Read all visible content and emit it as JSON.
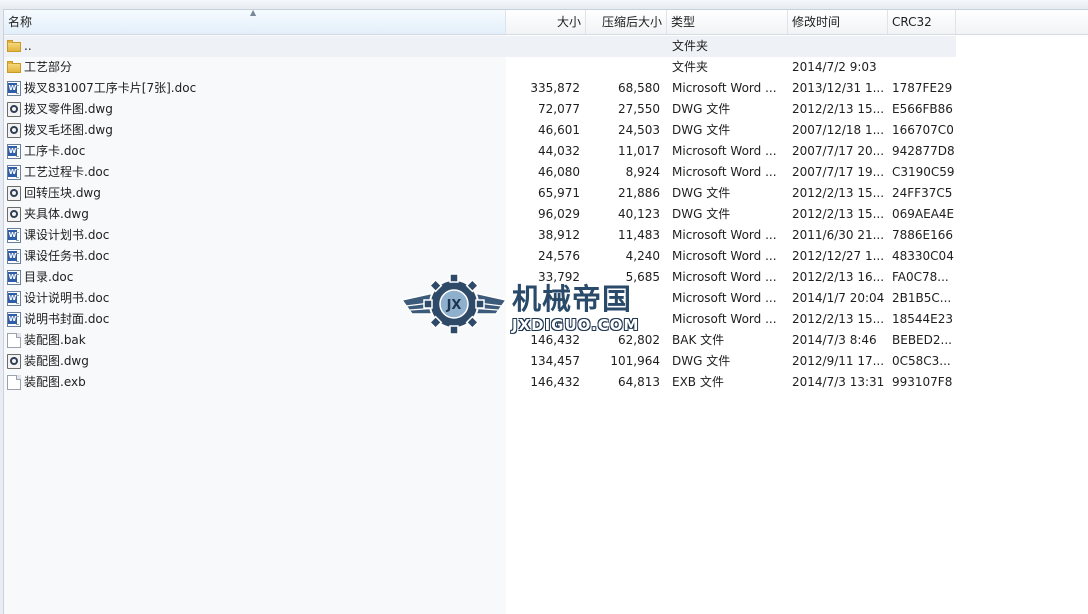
{
  "columns": {
    "name": "名称",
    "size": "大小",
    "compressed": "压缩后大小",
    "type": "类型",
    "modified": "修改时间",
    "crc": "CRC32"
  },
  "files": [
    {
      "name": "..",
      "icon": "folder-icon",
      "size": "",
      "compressed": "",
      "type": "文件夹",
      "modified": "",
      "crc": ""
    },
    {
      "name": "工艺部分",
      "icon": "folder-icon",
      "size": "",
      "compressed": "",
      "type": "文件夹",
      "modified": "2014/7/2 9:03",
      "crc": ""
    },
    {
      "name": "拨叉831007工序卡片[7张].doc",
      "icon": "word-doc-icon",
      "size": "335,872",
      "compressed": "68,580",
      "type": "Microsoft Word ...",
      "modified": "2013/12/31 1...",
      "crc": "1787FE29"
    },
    {
      "name": "拨叉零件图.dwg",
      "icon": "dwg-file-icon",
      "size": "72,077",
      "compressed": "27,550",
      "type": "DWG 文件",
      "modified": "2012/2/13 15...",
      "crc": "E566FB86"
    },
    {
      "name": "拨叉毛坯图.dwg",
      "icon": "dwg-file-icon",
      "size": "46,601",
      "compressed": "24,503",
      "type": "DWG 文件",
      "modified": "2007/12/18 1...",
      "crc": "166707C0"
    },
    {
      "name": "工序卡.doc",
      "icon": "word-doc-icon",
      "size": "44,032",
      "compressed": "11,017",
      "type": "Microsoft Word ...",
      "modified": "2007/7/17 20...",
      "crc": "942877D8"
    },
    {
      "name": "工艺过程卡.doc",
      "icon": "word-doc-icon",
      "size": "46,080",
      "compressed": "8,924",
      "type": "Microsoft Word ...",
      "modified": "2007/7/17 19...",
      "crc": "C3190C59"
    },
    {
      "name": "回转压块.dwg",
      "icon": "dwg-file-icon",
      "size": "65,971",
      "compressed": "21,886",
      "type": "DWG 文件",
      "modified": "2012/2/13 15...",
      "crc": "24FF37C5"
    },
    {
      "name": "夹具体.dwg",
      "icon": "dwg-file-icon",
      "size": "96,029",
      "compressed": "40,123",
      "type": "DWG 文件",
      "modified": "2012/2/13 15...",
      "crc": "069AEA4E"
    },
    {
      "name": "课设计划书.doc",
      "icon": "word-doc-icon",
      "size": "38,912",
      "compressed": "11,483",
      "type": "Microsoft Word ...",
      "modified": "2011/6/30 21...",
      "crc": "7886E166"
    },
    {
      "name": "课设任务书.doc",
      "icon": "word-doc-icon",
      "size": "24,576",
      "compressed": "4,240",
      "type": "Microsoft Word ...",
      "modified": "2012/12/27 1...",
      "crc": "48330C04"
    },
    {
      "name": "目录.doc",
      "icon": "word-doc-icon",
      "size": "33,792",
      "compressed": "5,685",
      "type": "Microsoft Word ...",
      "modified": "2012/2/13 16...",
      "crc": "FA0C78..."
    },
    {
      "name": "设计说明书.doc",
      "icon": "word-doc-icon",
      "size": "",
      "compressed": "",
      "type": "Microsoft Word ...",
      "modified": "2014/1/7 20:04",
      "crc": "2B1B5C..."
    },
    {
      "name": "说明书封面.doc",
      "icon": "word-doc-icon",
      "size": "",
      "compressed": "",
      "type": "Microsoft Word ...",
      "modified": "2012/2/13 15...",
      "crc": "18544E23"
    },
    {
      "name": "装配图.bak",
      "icon": "blank-file-icon",
      "size": "146,432",
      "compressed": "62,802",
      "type": "BAK 文件",
      "modified": "2014/7/3 8:46",
      "crc": "BEBED2..."
    },
    {
      "name": "装配图.dwg",
      "icon": "dwg-file-icon",
      "size": "134,457",
      "compressed": "101,964",
      "type": "DWG 文件",
      "modified": "2012/9/11 17...",
      "crc": "0C58C3..."
    },
    {
      "name": "装配图.exb",
      "icon": "blank-file-icon",
      "size": "146,432",
      "compressed": "64,813",
      "type": "EXB 文件",
      "modified": "2014/7/3 13:31",
      "crc": "993107F8"
    }
  ],
  "watermark": {
    "title": "机械帝国",
    "site": "JXDIGUO.COM",
    "logo_letters": "JX"
  }
}
